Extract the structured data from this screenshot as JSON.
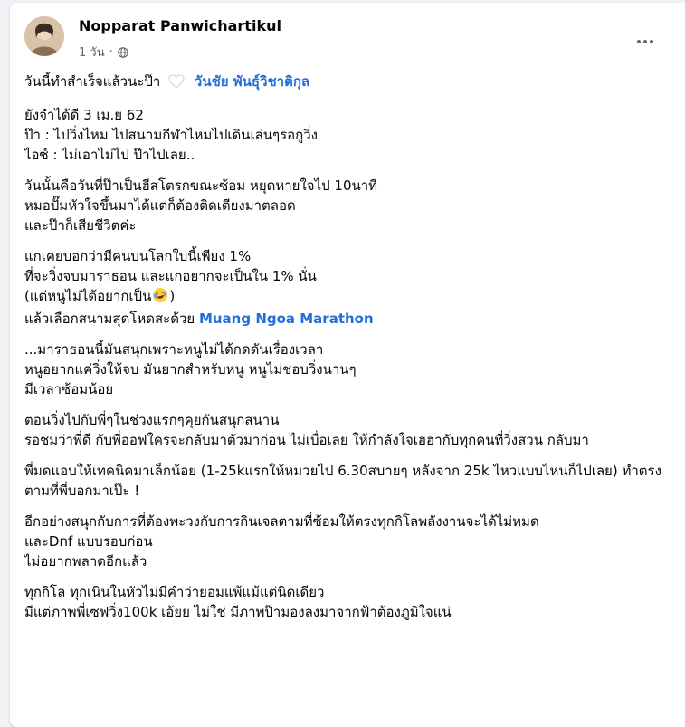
{
  "post": {
    "author": "Nopparat Panwichartikul",
    "time": "1 วัน",
    "separator": "·",
    "intro": {
      "text": "วันนี้ทำสำเร็จแล้วนะป๊า",
      "mention": "วันชัย พันธุ์วิชาติกุล"
    },
    "p1": [
      "ยังจำได้ดี 3 เม.ย 62",
      "ป๊า : ไปวิ่งไหม ไปสนามกีฬาไหมไปเดินเล่นๆรอกูวิ่ง",
      "ไอซ์ : ไม่เอาไม่ไป ป๊าไปเลย.."
    ],
    "p2": [
      "วันนั้นคือวันที่ป๊าเป็นฮีสโตรกขณะซ้อม หยุดหายใจไป 10นาที",
      "หมอปั๊มหัวใจขึ้นมาได้แต่ก็ต้องติดเตียงมาตลอด",
      "และป๊าก็เสียชีวิตค่ะ"
    ],
    "p3": {
      "l1": "แกเคยบอกว่ามีคนบนโลกใบนี้เพียง 1%",
      "l2": "ที่จะวิ่งจบมาราธอน และแกอยากจะเป็นใน 1% นั่น",
      "l3_before": "(แต่หนูไม่ได้อยากเป็น",
      "l3_after": ")",
      "l4_text": "แล้วเลือกสนามสุดโหดสะด้วย",
      "l4_link": "Muang Ngoa Marathon"
    },
    "p4": [
      "...มาราธอนนี้มันสนุกเพราะหนูไม่ได้กดดันเรื่องเวลา",
      "หนูอยากแค่วิ่งให้จบ มันยากสำหรับหนู หนูไม่ชอบวิ่งนานๆ",
      "มีเวลาซ้อมน้อย"
    ],
    "p5": [
      "ตอนวิ่งไปกับพี่ๆในช่วงแรกๆคุยกันสนุกสนาน",
      "รอชมว่าพี่ดี กับพี่ออฟใครจะกลับมาตัวมาก่อน ไม่เบื่อเลย ให้กำลังใจเฮฮากับทุกคนที่วิ่งสวน กลับมา"
    ],
    "p6": "พี่มดแอบให้เทคนิคมาเล็กน้อย (1-25kแรกให้หมวยไป 6.30สบายๆ หลังจาก 25k ไหวแบบไหนก็ไปเลย) ทำตรงตามที่พี่บอกมาเป๊ะ !",
    "p7": [
      "อีกอย่างสนุกกับการที่ต้องพะวงกับการกินเจลตามที่ซ้อมให้ตรงทุกกิโลพลังงานจะได้ไม่หมด",
      "และDnf แบบรอบก่อน",
      "ไม่อยากพลาดอีกแล้ว"
    ],
    "p8": [
      "ทุกกิโล ทุกเนินในหัวไม่มีคำว่ายอมแพ้แม้แต่นิดเดียว",
      "มีแต่ภาพพี่เซฟวิ่ง100k เอ้ยย ไม่ใช่ มีภาพป๊ามองลงมาจากฟ้าต้องภูมิใจแน่"
    ]
  },
  "icons": {
    "privacy": "globe-icon",
    "menu": "more-options-icon",
    "heart": "white-heart-emoji",
    "laugh": "laughing-emoji"
  },
  "colors": {
    "mention": "#216fdb",
    "secondary_text": "#65676b",
    "primary_text": "#050505",
    "background": "#f0f2f5"
  }
}
